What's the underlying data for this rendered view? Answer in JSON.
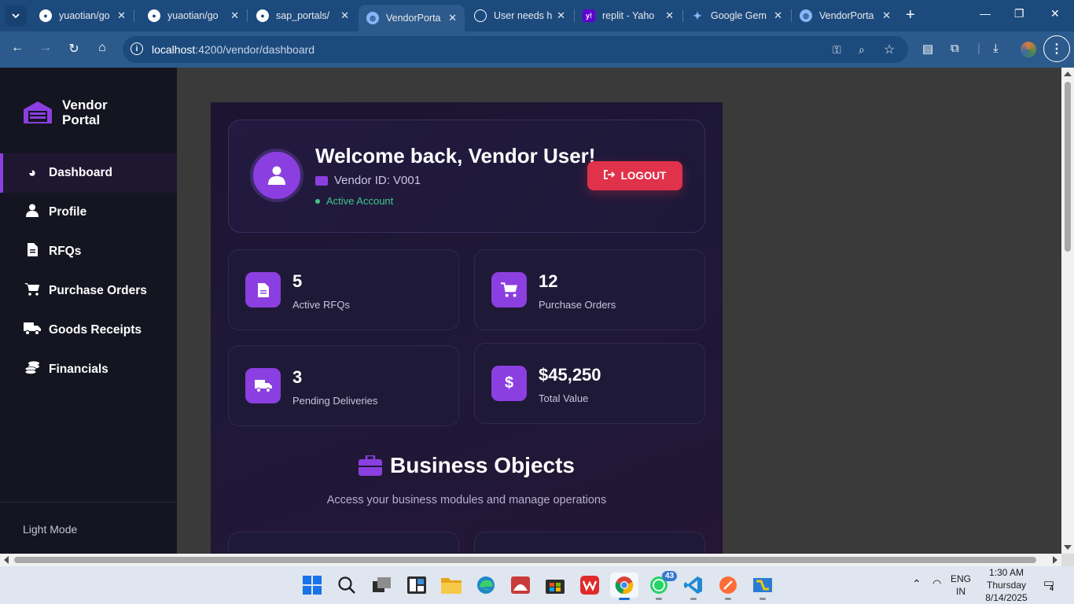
{
  "browser": {
    "tabs": [
      {
        "title": "yuaotian/go",
        "icon": "github-icon",
        "active": false
      },
      {
        "title": "yuaotian/go",
        "icon": "github-icon",
        "active": false
      },
      {
        "title": "sap_portals/",
        "icon": "github-icon",
        "active": false
      },
      {
        "title": "VendorPorta",
        "icon": "globe-icon",
        "active": true
      },
      {
        "title": "User needs h",
        "icon": "chatgpt-icon",
        "active": false
      },
      {
        "title": "replit - Yaho",
        "icon": "yahoo-icon",
        "active": false
      },
      {
        "title": "Google Gem",
        "icon": "gemini-icon",
        "active": false
      },
      {
        "title": "VendorPorta",
        "icon": "globe-icon",
        "active": false
      }
    ],
    "url_host": "localhost",
    "url_rest": ":4200/vendor/dashboard"
  },
  "sidebar": {
    "brand_line1": "Vendor",
    "brand_line2": "Portal",
    "items": [
      {
        "label": "Dashboard",
        "icon": "palette-icon",
        "active": true
      },
      {
        "label": "Profile",
        "icon": "user-icon",
        "active": false
      },
      {
        "label": "RFQs",
        "icon": "file-icon",
        "active": false
      },
      {
        "label": "Purchase Orders",
        "icon": "cart-icon",
        "active": false
      },
      {
        "label": "Goods Receipts",
        "icon": "truck-icon",
        "active": false
      },
      {
        "label": "Financials",
        "icon": "coins-icon",
        "active": false
      }
    ],
    "theme_toggle": "Light Mode"
  },
  "welcome": {
    "title": "Welcome back, Vendor User!",
    "vendor_id": "Vendor ID: V001",
    "status": "Active Account",
    "logout": "LOGOUT"
  },
  "stats": [
    {
      "value": "5",
      "label": "Active RFQs",
      "icon": "file-icon"
    },
    {
      "value": "12",
      "label": "Purchase Orders",
      "icon": "cart-icon"
    },
    {
      "value": "3",
      "label": "Pending Deliveries",
      "icon": "truck-icon"
    },
    {
      "value": "$45,250",
      "label": "Total Value",
      "icon": "dollar-icon"
    }
  ],
  "business_objects": {
    "title": "Business Objects",
    "subtitle": "Access your business modules and manage operations"
  },
  "taskbar": {
    "whatsapp_badge": "43",
    "lang_line1": "ENG",
    "lang_line2": "IN",
    "time": "1:30 AM",
    "day": "Thursday",
    "date": "8/14/2025",
    "notifications": "4"
  },
  "colors": {
    "accent": "#8b3fe0",
    "logout": "#e0324a",
    "active_status": "#3fc48a",
    "browser_chrome": "#2c5a8c"
  }
}
